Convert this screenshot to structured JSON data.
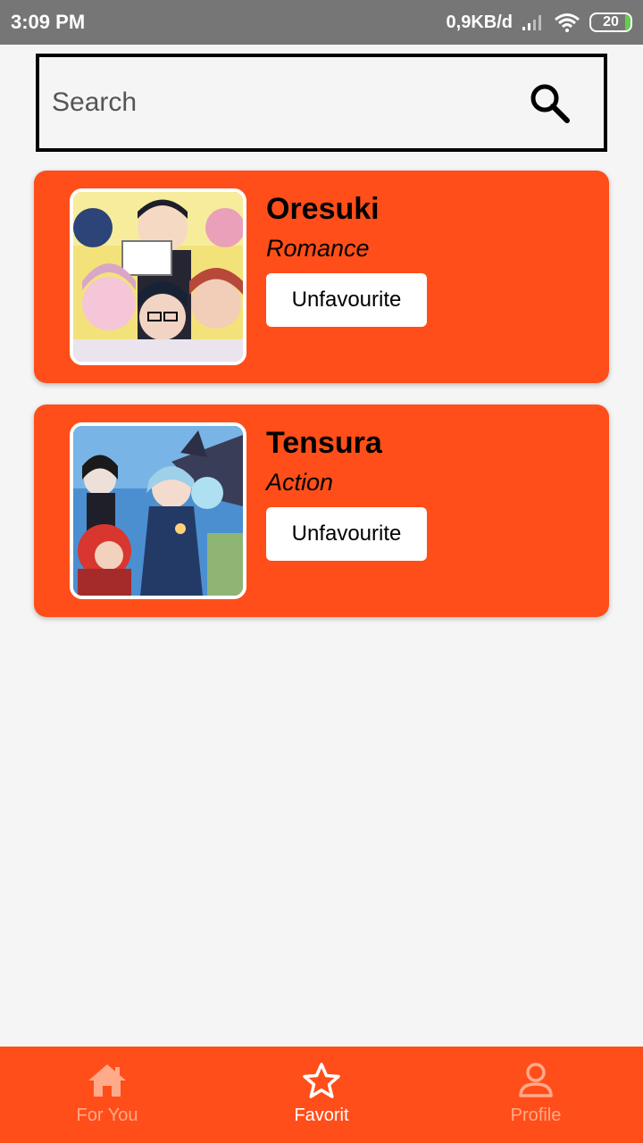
{
  "status_bar": {
    "time": "3:09 PM",
    "network_speed": "0,9KB/d",
    "battery": "20"
  },
  "search": {
    "placeholder": "Search"
  },
  "favorites": [
    {
      "title": "Oresuki",
      "genre": "Romance",
      "button_label": "Unfavourite"
    },
    {
      "title": "Tensura",
      "genre": "Action",
      "button_label": "Unfavourite"
    }
  ],
  "bottom_nav": {
    "items": [
      {
        "label": "For You",
        "icon": "home-icon",
        "active": false
      },
      {
        "label": "Favorit",
        "icon": "star-icon",
        "active": true
      },
      {
        "label": "Profile",
        "icon": "profile-icon",
        "active": false
      }
    ]
  },
  "colors": {
    "accent": "#ff4e1a",
    "status_bar": "#767676",
    "background": "#f5f5f5",
    "nav_inactive": "#ffaa8a"
  }
}
